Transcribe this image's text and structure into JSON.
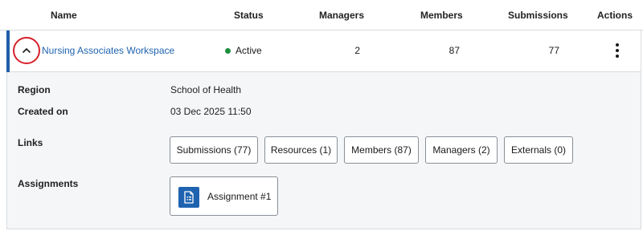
{
  "table": {
    "headers": {
      "name": "Name",
      "status": "Status",
      "managers": "Managers",
      "members": "Members",
      "submissions": "Submissions",
      "actions": "Actions"
    },
    "row": {
      "name": "Nursing Associates Workspace",
      "status": "Active",
      "status_color": "#1e8e3e",
      "managers": "2",
      "members": "87",
      "submissions": "77",
      "toggle_icon": "chevron-up-icon",
      "actions_icon": "kebab-menu-icon"
    }
  },
  "details": {
    "region_label": "Region",
    "region_value": "School of Health",
    "created_label": "Created on",
    "created_value": "03 Dec 2025 11:50",
    "links_label": "Links",
    "links": [
      {
        "label": "Submissions (77)"
      },
      {
        "label": "Resources (1)"
      },
      {
        "label": "Members (87)"
      },
      {
        "label": "Managers (2)"
      },
      {
        "label": "Externals (0)"
      }
    ],
    "assignments_label": "Assignments",
    "assignments": [
      {
        "label": "Assignment #1",
        "icon": "document-icon"
      }
    ]
  },
  "colors": {
    "accent": "#1f5ea8",
    "link": "#1f63b0",
    "highlight_circle": "#d6212a",
    "panel_bg": "#f4f6f8"
  }
}
